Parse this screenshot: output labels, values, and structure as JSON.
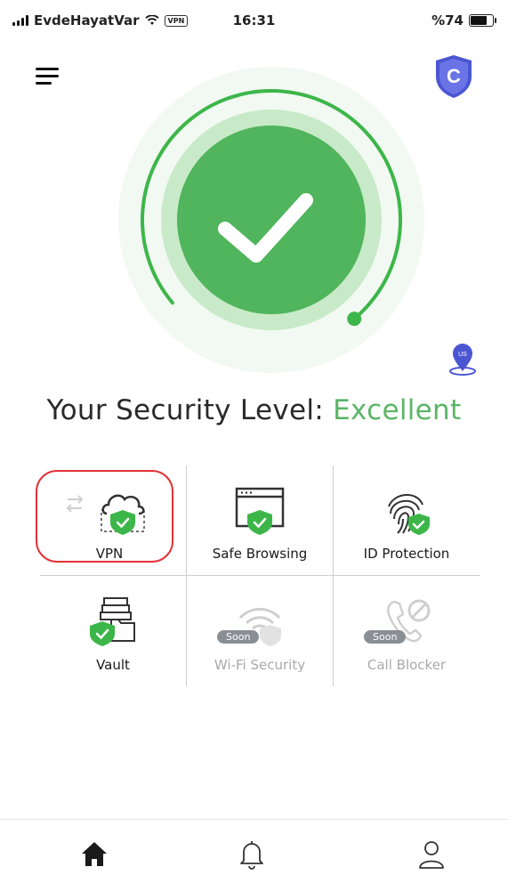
{
  "status_bar": {
    "carrier": "EvdeHayatVar",
    "vpn_indicator": "VPN",
    "time": "16:31",
    "battery_text": "%74",
    "battery_level": 0.74
  },
  "header": {
    "menu_icon": "hamburger-menu-icon",
    "brand_icon": "shield-logo-icon",
    "brand_letter": "C"
  },
  "gauge": {
    "status_icon": "checkmark-icon",
    "level": 0.9
  },
  "location": {
    "icon": "location-pin-icon",
    "country_code": "US"
  },
  "security": {
    "label": "Your Security Level: ",
    "value": "Excellent"
  },
  "features": [
    {
      "label": "VPN",
      "icon": "vpn-cloud-icon",
      "enabled": true
    },
    {
      "label": "Safe Browsing",
      "icon": "browser-shield-icon",
      "enabled": true
    },
    {
      "label": "ID Protection",
      "icon": "fingerprint-icon",
      "enabled": true
    },
    {
      "label": "Vault",
      "icon": "vault-folder-icon",
      "enabled": true
    },
    {
      "label": "Wi-Fi Security",
      "icon": "wifi-shield-icon",
      "enabled": false,
      "badge": "Soon"
    },
    {
      "label": "Call Blocker",
      "icon": "call-block-icon",
      "enabled": false,
      "badge": "Soon"
    }
  ],
  "tabs": [
    {
      "icon": "home-icon",
      "active": true
    },
    {
      "icon": "bell-icon",
      "active": false
    },
    {
      "icon": "profile-icon",
      "active": false
    }
  ],
  "colors": {
    "accent_green": "#5cb567",
    "ring_green": "#3db649",
    "highlight_red": "#e23237",
    "brand_blue": "#4b56d2"
  }
}
